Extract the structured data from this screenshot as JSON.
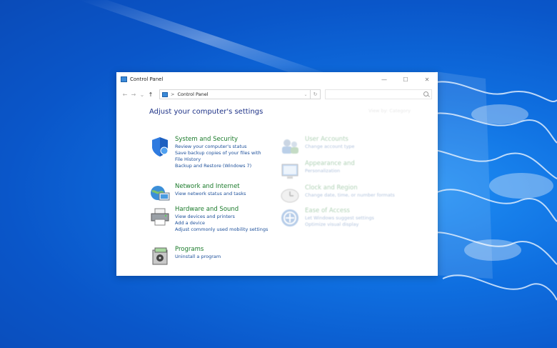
{
  "window": {
    "title": "Control Panel"
  },
  "titlebar": {
    "minimize": "—",
    "maximize": "☐",
    "close": "✕"
  },
  "nav": {
    "back": "←",
    "forward": "→",
    "dropdown": "⌄",
    "up": "↑"
  },
  "address": {
    "separator": ">",
    "path": "Control Panel",
    "dropdown": "⌄",
    "refresh": "↻"
  },
  "search": {
    "placeholder": ""
  },
  "heading": "Adjust your computer's settings",
  "view_by": "View by: Category",
  "categories_left": [
    {
      "title": "System and Security",
      "links": [
        "Review your computer's status",
        "Save backup copies of your files with",
        "File History",
        "Backup and Restore (Windows 7)"
      ]
    },
    {
      "title": "Network and Internet",
      "links": [
        "View network status and tasks"
      ]
    },
    {
      "title": "Hardware and Sound",
      "links": [
        "View devices and printers",
        "Add a device",
        "Adjust commonly used mobility settings"
      ]
    },
    {
      "title": "Programs",
      "links": [
        "Uninstall a program"
      ]
    }
  ],
  "categories_right": [
    {
      "title": "User Accounts",
      "links": [
        "Change account type"
      ]
    },
    {
      "title": "Appearance and",
      "links": [
        "Personalization"
      ]
    },
    {
      "title": "Clock and Region",
      "links": [
        "Change date, time, or number formats"
      ]
    },
    {
      "title": "Ease of Access",
      "links": [
        "Let Windows suggest settings",
        "Optimize visual display"
      ]
    }
  ]
}
